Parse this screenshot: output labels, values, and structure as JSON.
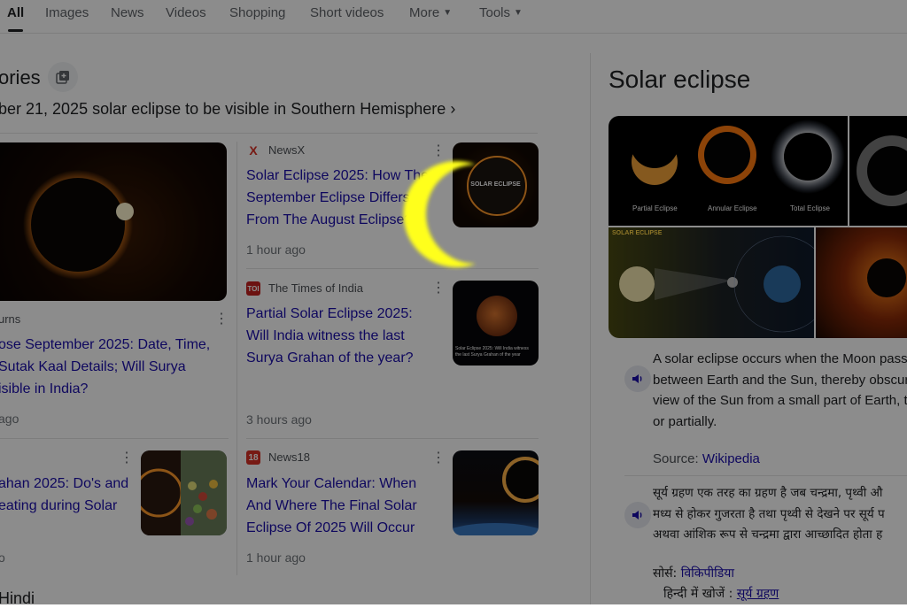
{
  "tabs": [
    {
      "label": "All",
      "active": true
    },
    {
      "label": "Images"
    },
    {
      "label": "News"
    },
    {
      "label": "Videos"
    },
    {
      "label": "Shopping"
    },
    {
      "label": "Short videos"
    },
    {
      "label": "More"
    },
    {
      "label": "Tools"
    }
  ],
  "top_stories": {
    "heading": "ories",
    "subheading": "ber 21, 2025 solar eclipse to be visible in Southern Hemisphere",
    "main_story": {
      "source": "urns",
      "headline": [
        "ose September 2025: Date, Time,",
        "Sutak Kaal Details; Will Surya",
        "isible in India?"
      ],
      "time": "ago"
    },
    "story_left_2": {
      "headline": [
        "ahan 2025: Do's and",
        "eating during Solar"
      ],
      "time": "o"
    },
    "stories": [
      {
        "source": "NewsX",
        "logo_color": "#d93025",
        "logo_text": "X",
        "headline": [
          "Solar Eclipse 2025: How The",
          "September Eclipse Differs",
          "From The August Eclipse?"
        ],
        "time": "1 hour ago",
        "thumb_text": "SOLAR ECLIPSE"
      },
      {
        "source": "The Times of India",
        "logo_color": "#c5221f",
        "logo_text": "TOI",
        "headline": [
          "Partial Solar Eclipse 2025:",
          "Will India witness the last",
          "Surya Grahan of the year?"
        ],
        "time": "3 hours ago",
        "thumb_text": "Solar Eclipse 2025: Will India witness the last Surya Grahan of the year"
      },
      {
        "source": "News18",
        "logo_color": "#d93025",
        "logo_text": "18",
        "headline": [
          "Mark Your Calendar: When",
          "And Where The Final Solar",
          "Eclipse Of 2025 Will Occur"
        ],
        "time": "1 hour ago"
      }
    ]
  },
  "bottom_heading": "Hindi",
  "knowledge_panel": {
    "title": "Solar eclipse",
    "gallery_labels": [
      "Partial Eclipse",
      "Annular Eclipse",
      "Total Eclipse"
    ],
    "diagram_title": "SOLAR ECLIPSE",
    "english_text": [
      "A solar eclipse occurs when the Moon pass",
      "between Earth and the Sun, thereby obscur",
      "view of the Sun from a small part of Earth, t",
      "or partially."
    ],
    "source_label": "Source:",
    "source_link": "Wikipedia",
    "hindi_text": [
      "सूर्य ग्रहण एक तरह का ग्रहण है जब चन्द्रमा, पृथ्वी औ",
      "मध्य से होकर गुजरता है तथा पृथ्वी से देखने पर सूर्य प",
      "अथवा आंशिक रूप से चन्द्रमा द्वारा आच्छादित होता ह"
    ],
    "hindi_source_label": "सोर्स:",
    "hindi_source_link": "विकिपीडिया",
    "hindi_search_label": "हिन्दी में खोजें :",
    "hindi_search_link": "सूर्य ग्रहण"
  }
}
